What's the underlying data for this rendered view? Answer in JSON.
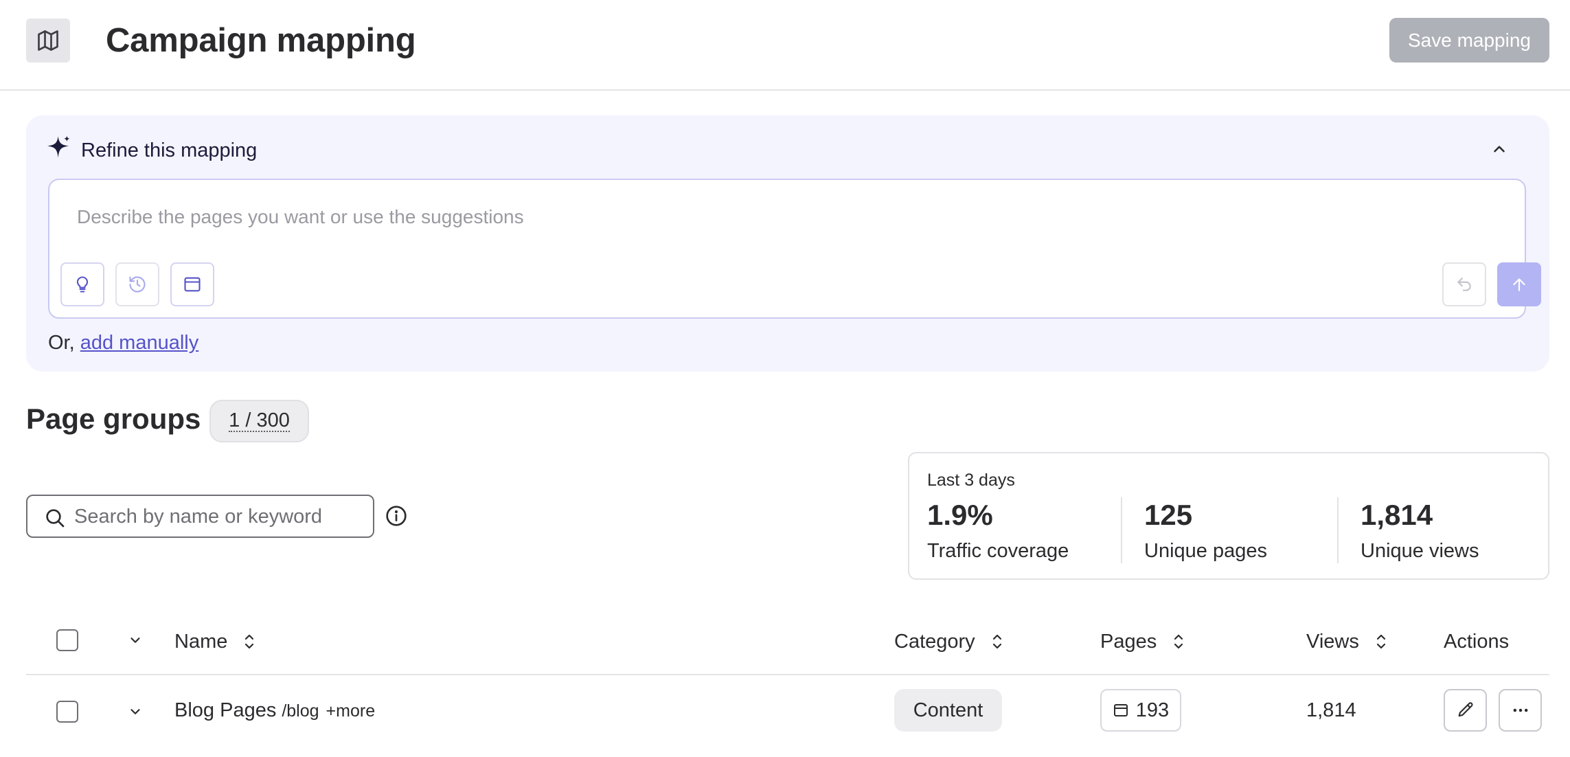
{
  "header": {
    "title": "Campaign mapping",
    "save_label": "Save mapping",
    "map_icon": "map-icon"
  },
  "refine": {
    "title": "Refine this mapping",
    "placeholder": "Describe the pages you want or use the suggestions",
    "tools": [
      "lightbulb-icon",
      "history-icon",
      "browser-window-icon"
    ],
    "or_text": "Or, ",
    "add_manually": "add manually",
    "accent_color": "#5553c9",
    "panel_background": "#f4f4fe"
  },
  "groups": {
    "title": "Page groups",
    "count": "1 / 300",
    "search_placeholder": "Search by name or keyword"
  },
  "stats": {
    "period": "Last 3 days",
    "items": [
      {
        "value": "1.9%",
        "label": "Traffic coverage"
      },
      {
        "value": "125",
        "label": "Unique pages"
      },
      {
        "value": "1,814",
        "label": "Unique views"
      }
    ]
  },
  "table": {
    "columns": {
      "name": "Name",
      "category": "Category",
      "pages": "Pages",
      "views": "Views",
      "actions": "Actions"
    },
    "rows": [
      {
        "name": "Blog Pages",
        "path": "/blog",
        "more": "+more",
        "category": "Content",
        "pages": "193",
        "views": "1,814"
      }
    ]
  }
}
